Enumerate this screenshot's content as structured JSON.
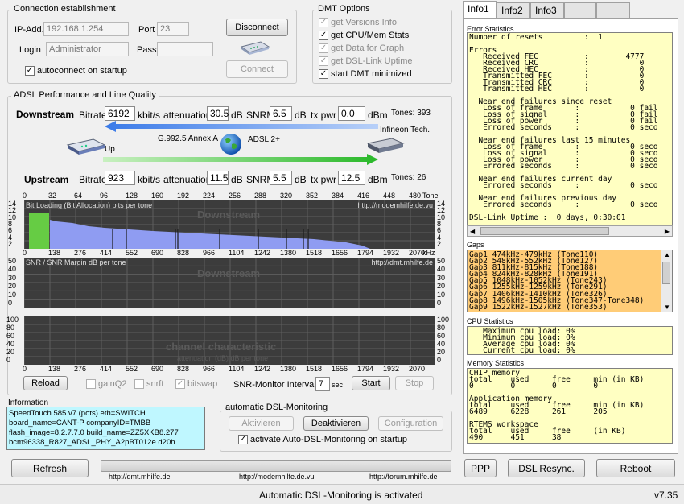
{
  "connection": {
    "title": "Connection establishment",
    "ip_label": "IP-Add.",
    "ip_value": "192.168.1.254",
    "port_label": "Port",
    "port_value": "23",
    "login_label": "Login",
    "login_value": "Administrator",
    "password_label": "Password",
    "password_value": "",
    "autoconnect_label": "autoconnect on startup",
    "disconnect_label": "Disconnect",
    "connect_label": "Connect"
  },
  "dmt_options": {
    "title": "DMT Options",
    "items": [
      {
        "label": "get Versions Info",
        "checked": true,
        "enabled": false
      },
      {
        "label": "get CPU/Mem Stats",
        "checked": true,
        "enabled": true
      },
      {
        "label": "get Data for Graph",
        "checked": true,
        "enabled": false
      },
      {
        "label": "get DSL-Link Uptime",
        "checked": true,
        "enabled": false
      },
      {
        "label": "start DMT minimized",
        "checked": true,
        "enabled": true
      }
    ]
  },
  "adsl": {
    "title": "ADSL Performance and Line Quality",
    "downstream_label": "Downstream",
    "upstream_label": "Upstream",
    "bitrate_label": "Bitrate",
    "kbits_label": "kbit/s",
    "attenuation_label": "attenuation",
    "db_label": "dB",
    "snrm_label": "SNRM",
    "txpwr_label": "tx pwr",
    "dbm_label": "dBm",
    "down": {
      "bitrate": "6192",
      "attenuation": "30.5",
      "snrm": "6.5",
      "txpwr": "0.0",
      "tones": "Tones: 393"
    },
    "up": {
      "bitrate": "923",
      "attenuation": "11.5",
      "snrm": "5.5",
      "txpwr": "12.5",
      "tones": "Tones: 26"
    },
    "mode": "G.992.5 Annex A",
    "standard": "ADSL 2+",
    "up_text": "Up",
    "peer": "Infineon Tech."
  },
  "charts": {
    "tone_ticks": [
      "0",
      "32",
      "64",
      "96",
      "128",
      "160",
      "192",
      "224",
      "256",
      "288",
      "320",
      "352",
      "384",
      "416",
      "448",
      "480"
    ],
    "tone_unit": "Tone",
    "khz_ticks": [
      "0",
      "138",
      "276",
      "414",
      "552",
      "690",
      "828",
      "966",
      "1104",
      "1242",
      "1380",
      "1518",
      "1656",
      "1794",
      "1932",
      "2070"
    ],
    "khz_unit": "kHz",
    "bitload": {
      "title": "Bit Loading (Bit Allocation)  bits per tone",
      "watermark": "Downstream",
      "url": "http://modemhilfe.de.vu",
      "y_ticks": [
        "14",
        "12",
        "10",
        "8",
        "6",
        "4",
        "2"
      ]
    },
    "snr": {
      "title": "SNR / SNR Margin  dB per tone",
      "watermark": "Downstream",
      "url": "http://dmt.mhilfe.de",
      "y_ticks": [
        "50",
        "40",
        "30",
        "20",
        "10",
        "0"
      ]
    },
    "channel": {
      "watermark": "channel characteristic",
      "subtitle": "attenuation (dB)  dB per tone",
      "y_ticks": [
        "100",
        "80",
        "60",
        "40",
        "20",
        "0"
      ]
    }
  },
  "chart_data": {
    "type": "bar",
    "title": "Bit Loading (Bit Allocation)  bits per tone",
    "xlabel": "Tone",
    "ylabel": "bits per tone",
    "xlim": [
      0,
      511
    ],
    "ylim": [
      0,
      15
    ],
    "series": [
      {
        "name": "Upstream",
        "color": "#66cc44",
        "x": [
          6,
          31
        ],
        "values": [
          11,
          11
        ]
      },
      {
        "name": "Downstream",
        "color": "#8f9cf2",
        "x": [
          32,
          40,
          60,
          80,
          100,
          130,
          160,
          200,
          240,
          280,
          320,
          360,
          400,
          420,
          430
        ],
        "values": [
          9,
          8.5,
          8,
          7,
          6.5,
          6,
          5.5,
          5,
          4.5,
          4,
          3.5,
          3,
          2,
          1,
          0
        ]
      }
    ]
  },
  "controls": {
    "reload": "Reload",
    "gainq2": "gainQ2",
    "snrft": "snrft",
    "bitswap": "bitswap",
    "snr_interval_label": "SNR-Monitor Interval:",
    "snr_interval_value": "7",
    "sec_label": "sec",
    "start": "Start",
    "stop": "Stop"
  },
  "information": {
    "title": "Information",
    "lines": [
      "SpeedTouch 585 v7 (pots) eth=SWITCH",
      "board_name=CANT-P   companyID=TMBB",
      "flash_image=8.2.7.7.0  build_name=ZZ5XKB8.277",
      "bcm96338_R827_ADSL_PHY_A2pBT012e.d20h"
    ]
  },
  "monitoring": {
    "title": "automatic DSL-Monitoring",
    "activate": "Aktivieren",
    "deactivate": "Deaktivieren",
    "configuration": "Configuration",
    "checkbox_label": "activate Auto-DSL-Monitoring on startup"
  },
  "bottom": {
    "refresh": "Refresh",
    "url1": "http://dmt.mhilfe.de",
    "url2": "http://modemhilfe.de.vu",
    "url3": "http://forum.mhilfe.de",
    "ppp": "PPP",
    "resync": "DSL Resync.",
    "reboot": "Reboot"
  },
  "status": {
    "message": "Automatic DSL-Monitoring is activated",
    "version": "v7.35"
  },
  "tabs": [
    "Info1",
    "Info2",
    "Info3"
  ],
  "error_stats": {
    "title": "Error Statistics",
    "text": "Number of resets         :  1\n\nErrors\n   Received FEC          :        4777\n   Received CRC          :           0\n   Received HEC          :           0\n   Transmitted FEC       :           0\n   Transmitted CRC       :           0\n   Transmitted HEC       :           0\n\n  Near end failures since reset\n   Loss of frame       :           0 fail\n   Loss of signal      :           0 fail\n   Loss of power       :           0 fail\n   Errored seconds     :           0 seco\n\n  Near end failures last 15 minutes\n   Loss of frame       :           0 seco\n   Loss of signal      :           0 seco\n   Loss of power       :           0 seco\n   Errored seconds     :           0 seco\n\n  Near end failures current day\n   Errored seconds     :           0 seco\n\n  Near end failures previous day\n   Errored seconds     :           0 seco\n\nDSL-Link Uptime :  0 days, 0:30:01"
  },
  "gaps": {
    "title": "Gaps",
    "items": [
      "Gap1 474kHz-479kHz (Tone110)",
      "Gap2 548kHz-552kHz (Tone127)",
      "Gap3 811kHz-815kHz (Tone188)",
      "Gap4 824kHz-828kHz (Tone191)",
      "Gap5 1048kHz-1052kHz (Tone243)",
      "Gap6 1255kHz-1259kHz (Tone291)",
      "Gap7 1406kHz-1410kHz (Tone326)",
      "Gap8 1496kHz-1505kHz (Tone347-Tone348)",
      "Gap9 1522kHz-1527kHz (Tone353)"
    ]
  },
  "cpu_stats": {
    "title": "CPU Statistics",
    "text": "   Maximum cpu load: 0%\n   Minimum cpu load: 0%\n   Average cpu load: 0%\n   Current cpu load: 0%"
  },
  "memory_stats": {
    "title": "Memory Statistics",
    "text": "CHIP memory\ntotal    used     free     min (in KB)\n0        0        0        0\n\nApplication memory\ntotal    used     free     min (in KB)\n6489     6228     261      205\n\nRTEMS workspace\ntotal    used     free     (in KB)\n490      451      38"
  }
}
